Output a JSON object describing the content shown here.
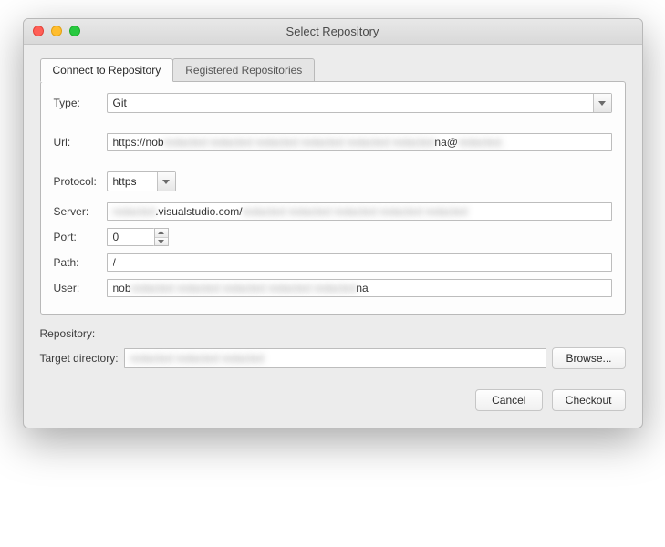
{
  "window": {
    "title": "Select Repository"
  },
  "tabs": {
    "connect": "Connect to Repository",
    "registered": "Registered Repositories"
  },
  "form": {
    "type_label": "Type:",
    "type_value": "Git",
    "url_label": "Url:",
    "url_prefix": "https://nob",
    "url_mid": "redacted redacted redacted redacted redacted redacted",
    "url_suffix": "na@",
    "url_tail": "redacted.",
    "protocol_label": "Protocol:",
    "protocol_value": "https",
    "server_label": "Server:",
    "server_blur1": "redacted",
    "server_vis": ".visualstudio.com/",
    "server_blur2": "redacted redacted redacted redacted redacted",
    "port_label": "Port:",
    "port_value": "0",
    "path_label": "Path:",
    "path_value": "/",
    "user_label": "User:",
    "user_prefix": "nob",
    "user_blur": "redacted redacted redacted redacted redacted",
    "user_suffix": "na"
  },
  "below": {
    "repo_label": "Repository:",
    "target_label": "Target directory:",
    "target_value": "redacted redacted redacted",
    "browse": "Browse..."
  },
  "actions": {
    "cancel": "Cancel",
    "checkout": "Checkout"
  }
}
